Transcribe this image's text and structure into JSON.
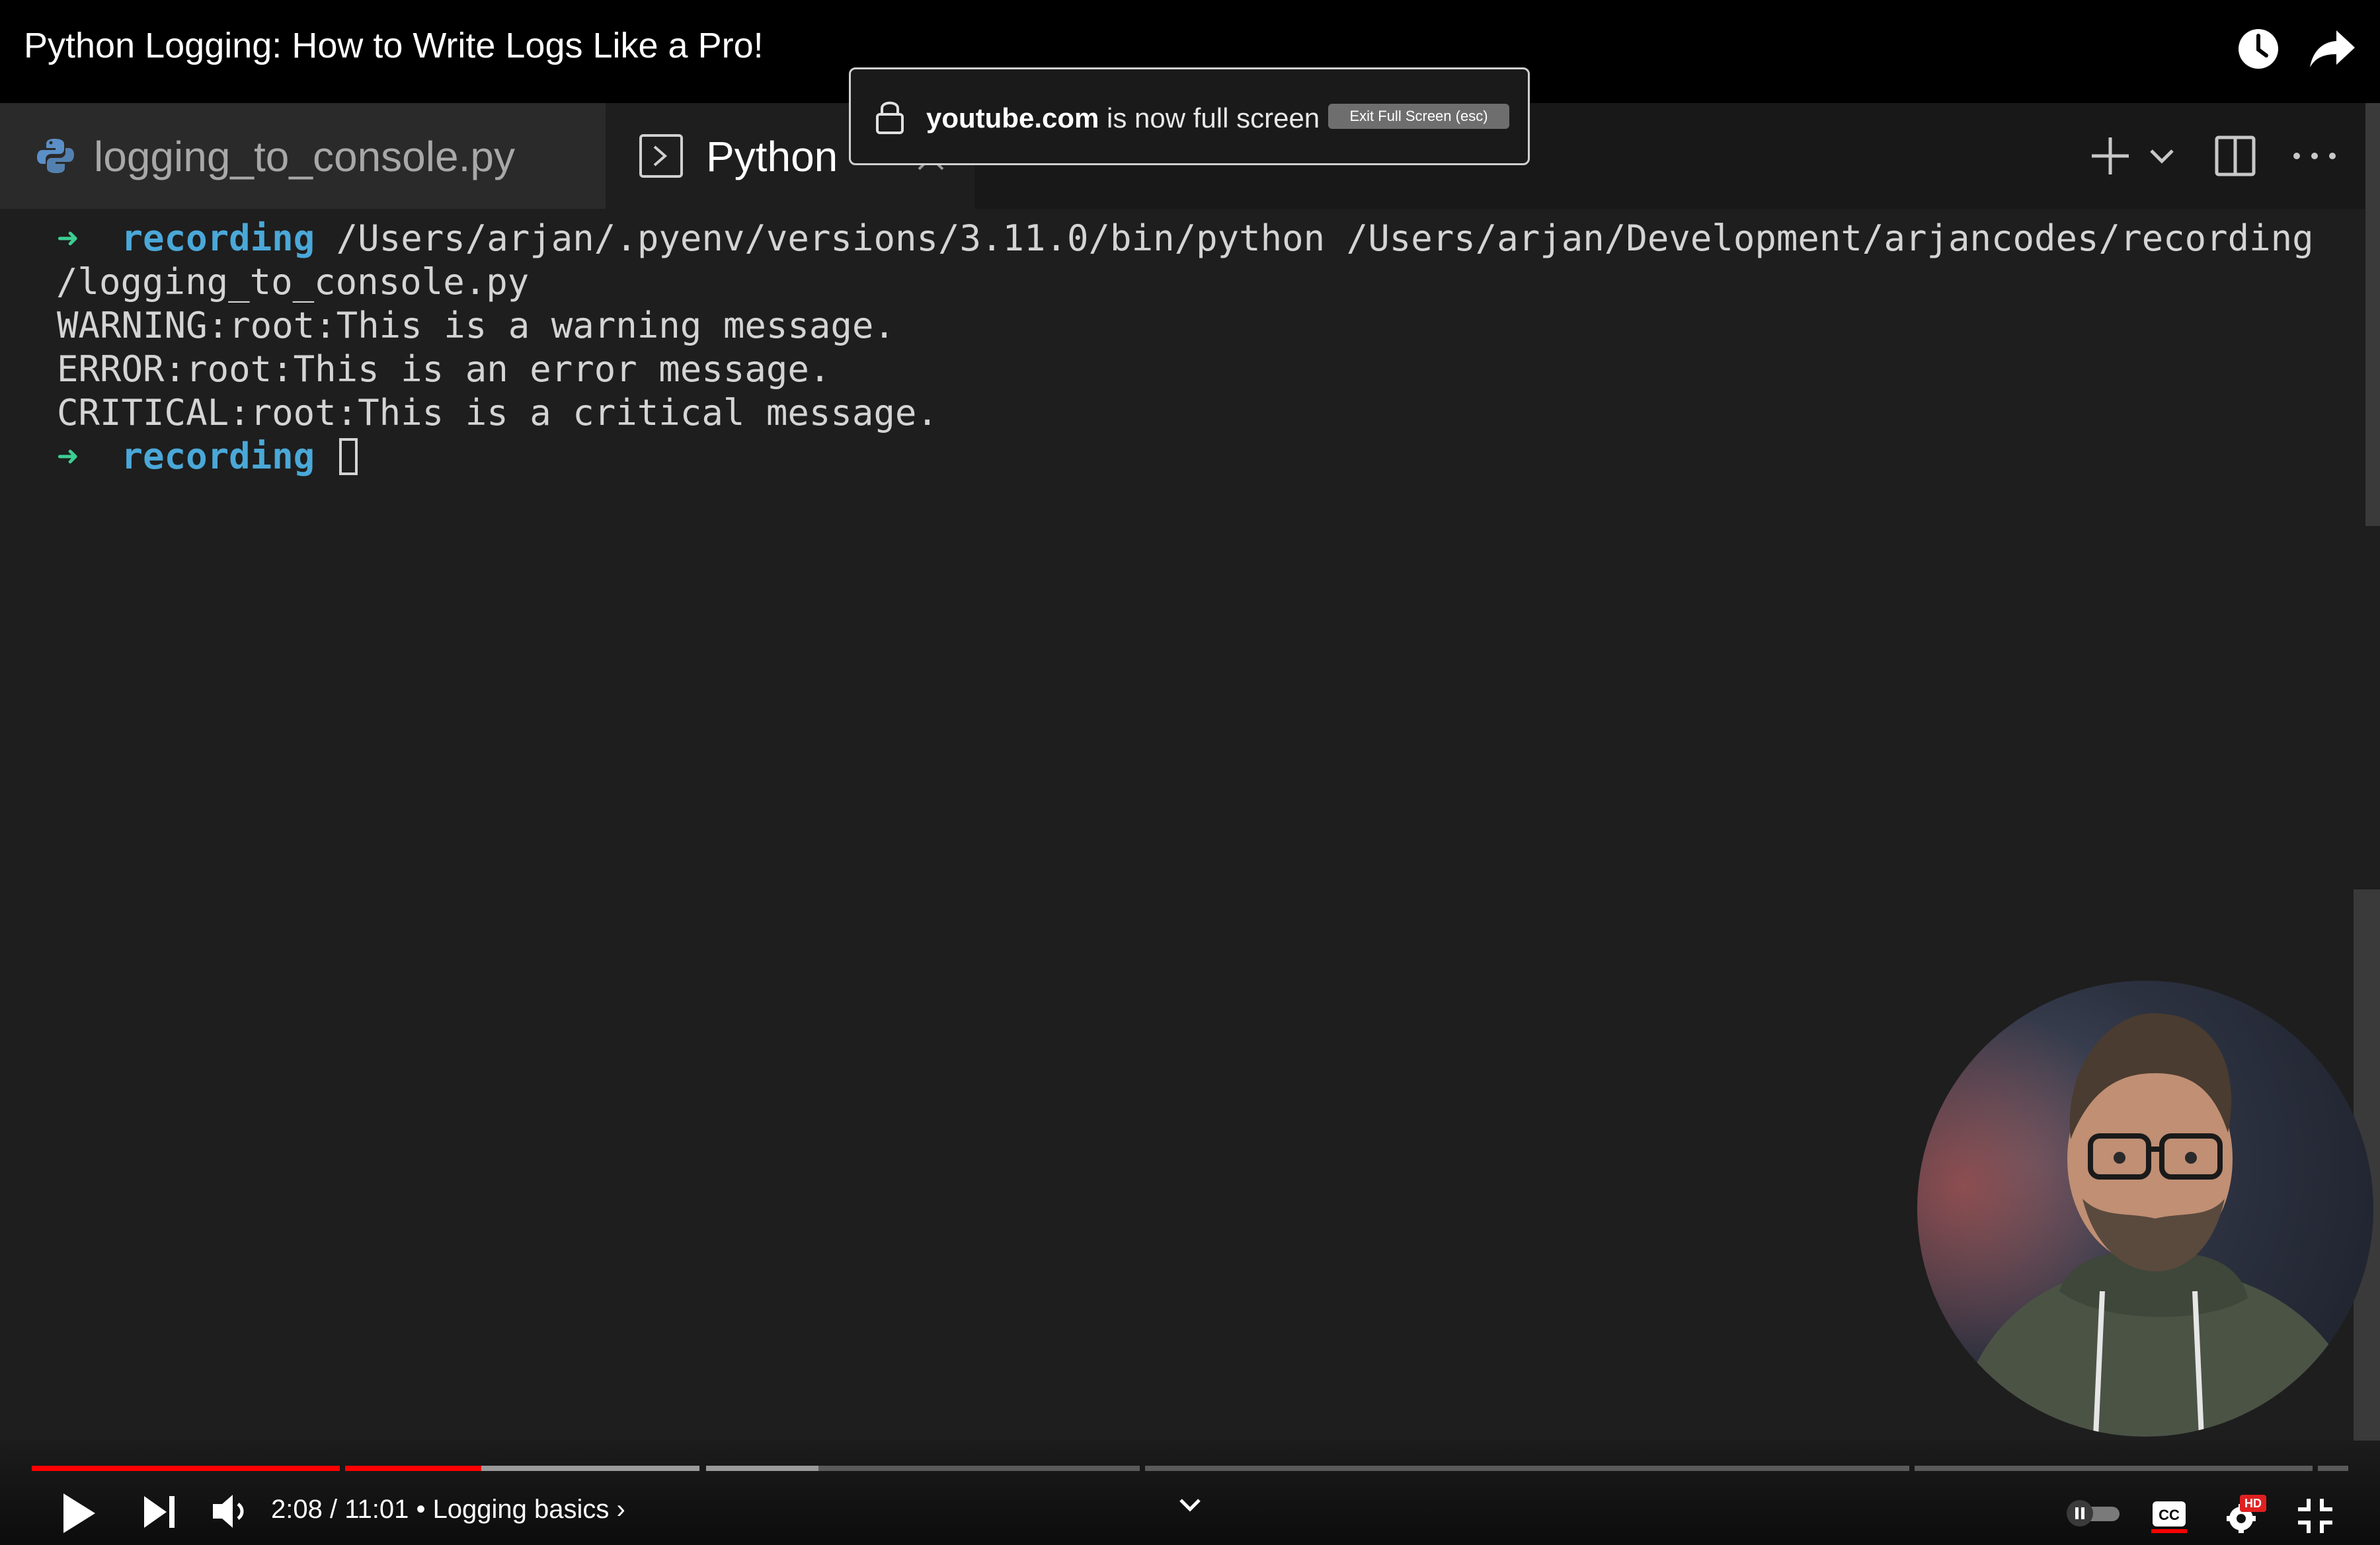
{
  "video": {
    "title": "Python Logging: How to Write Logs Like a Pro!"
  },
  "editor": {
    "tabs": [
      {
        "label": "logging_to_console.py",
        "icon": "python-icon",
        "active": false
      },
      {
        "label": "Python",
        "icon": "terminal-icon",
        "active": true
      }
    ]
  },
  "fullscreen_notice": {
    "domain": "youtube.com",
    "text": " is now full screen",
    "button": "Exit Full Screen (esc)"
  },
  "terminal": {
    "prompt_arrow": "➜",
    "prompt_dir": "recording",
    "command": "/Users/arjan/.pyenv/versions/3.11.0/bin/python /Users/arjan/Development/arjancodes/recording",
    "command_cont": "/logging_to_console.py",
    "output": [
      "WARNING:root:This is a warning message.",
      "ERROR:root:This is an error message.",
      "CRITICAL:root:This is a critical message."
    ]
  },
  "player": {
    "time": "2:08 / 11:01",
    "chapter_sep": " • ",
    "chapter": "Logging basics",
    "chapter_arrow": " ›",
    "hd_badge": "HD",
    "colors": {
      "progress_played": "#ff0000",
      "progress_buffered": "#9a9a9a",
      "progress_track": "#5a5a5a"
    }
  }
}
